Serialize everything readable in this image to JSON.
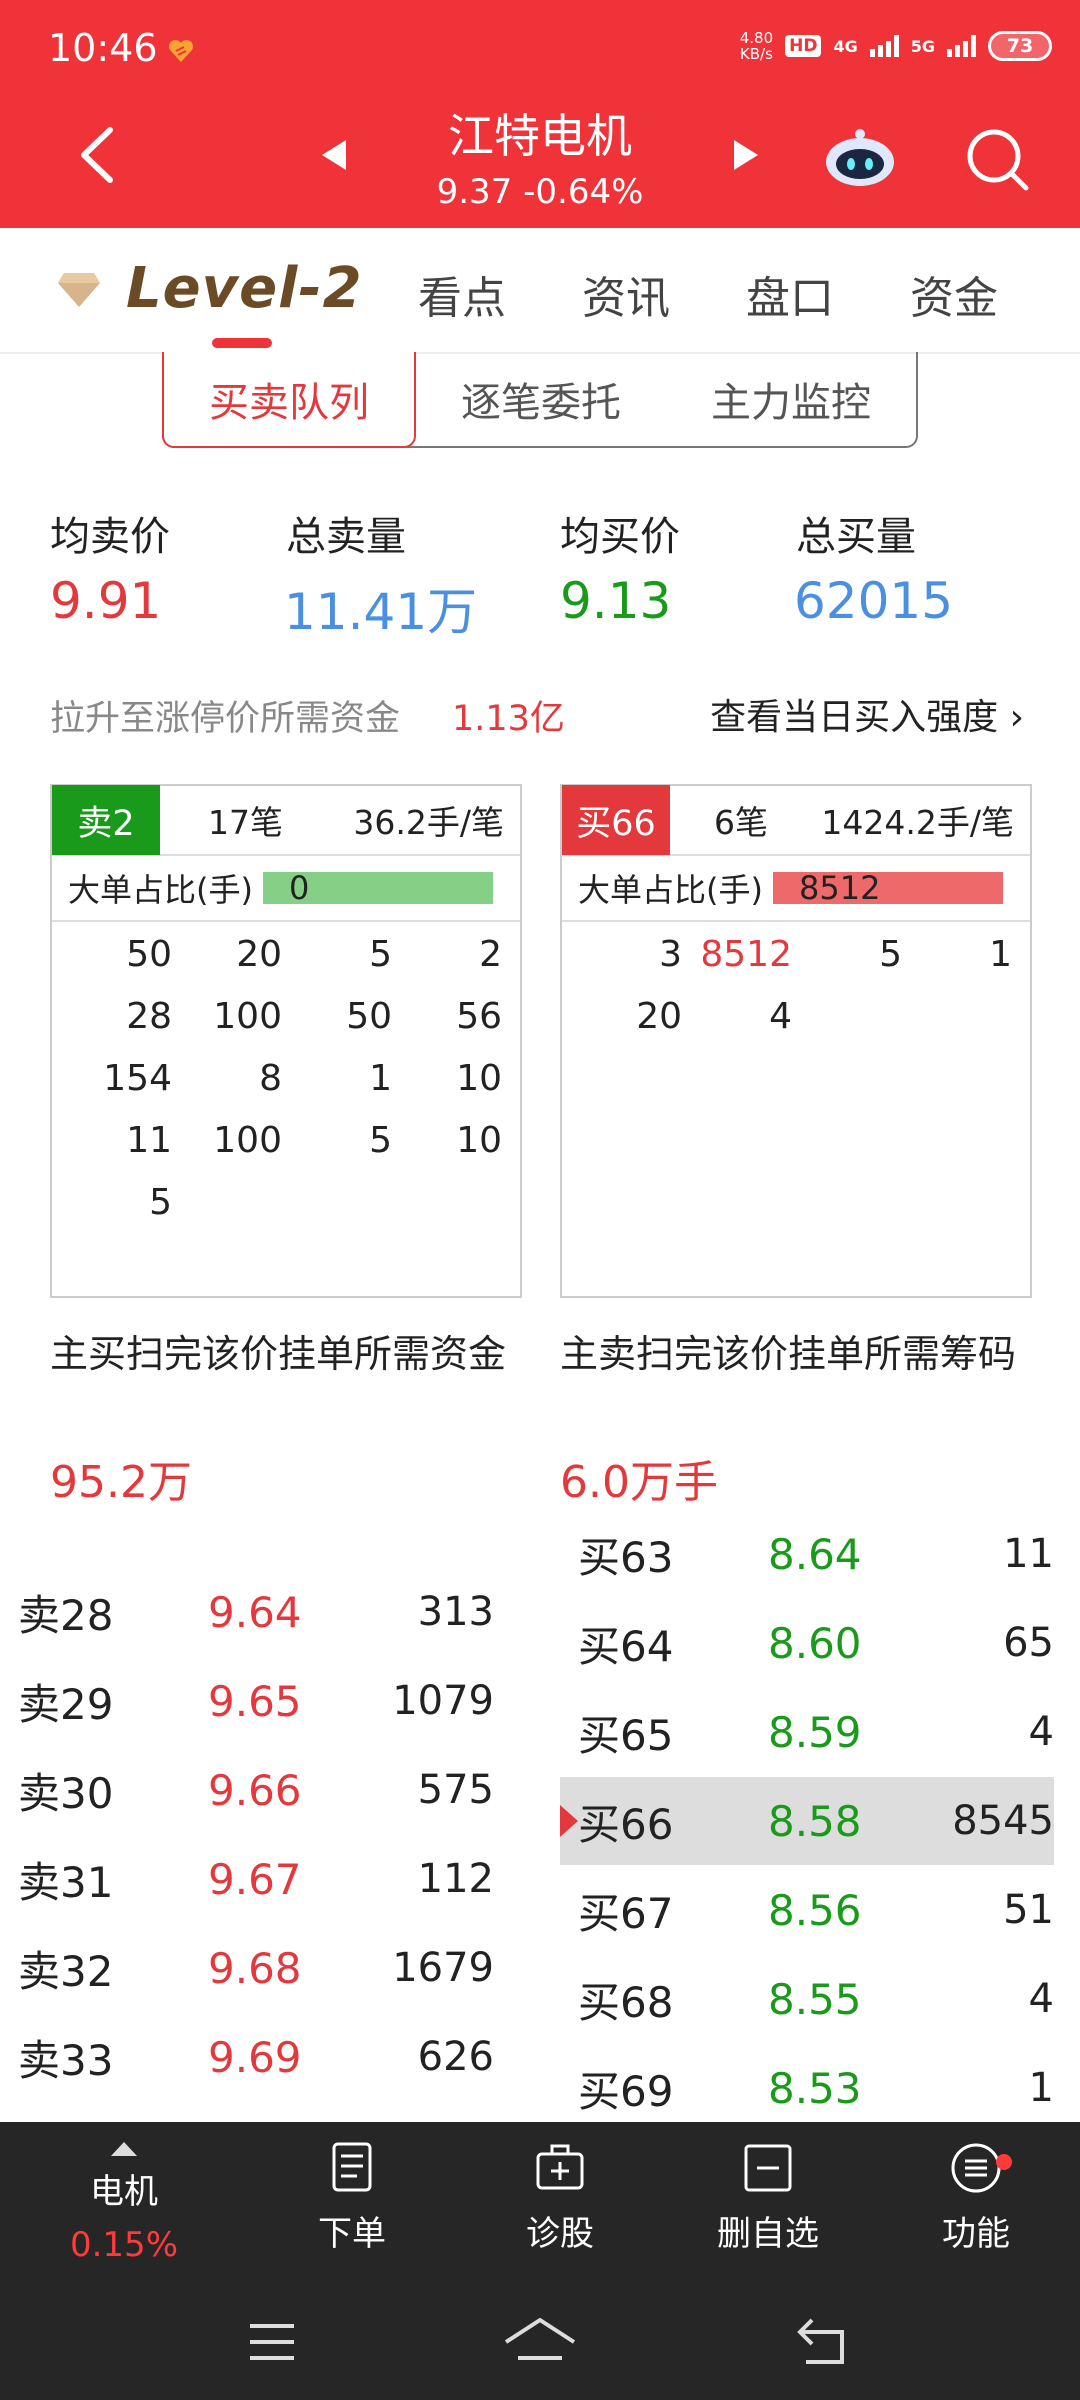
{
  "status": {
    "time": "10:46",
    "speed_top": "4.80",
    "speed_bottom": "KB/s",
    "hd": "HD",
    "net1": "4G",
    "net2": "5G",
    "battery": "73"
  },
  "header": {
    "stock_name": "江特电机",
    "quote": "9.37 -0.64%"
  },
  "tabs": {
    "level2": "Level-2",
    "items": [
      "看点",
      "资讯",
      "盘口",
      "资金"
    ]
  },
  "segmented": [
    "买卖队列",
    "逐笔委托",
    "主力监控"
  ],
  "stats": {
    "avg_sell_label": "均卖价",
    "avg_sell": "9.91",
    "total_sell_label": "总卖量",
    "total_sell": "11.41万",
    "avg_buy_label": "均买价",
    "avg_buy": "9.13",
    "total_buy_label": "总买量",
    "total_buy": "62015"
  },
  "raise": {
    "label": "拉升至涨停价所需资金",
    "value": "1.13亿",
    "link": "查看当日买入强度 ›"
  },
  "sell_queue": {
    "badge": "卖2",
    "count": "17笔",
    "avg": "36.2手/笔",
    "ratio_label": "大单占比(手)",
    "ratio_value": "0",
    "cells": [
      "50",
      "20",
      "5",
      "2",
      "28",
      "100",
      "50",
      "56",
      "154",
      "8",
      "1",
      "10",
      "11",
      "100",
      "5",
      "10",
      "5",
      "",
      "",
      ""
    ]
  },
  "buy_queue": {
    "badge": "买66",
    "count": "6笔",
    "avg": "1424.2手/笔",
    "ratio_label": "大单占比(手)",
    "ratio_value": "8512",
    "cells": [
      "3",
      "8512",
      "5",
      "1",
      "20",
      "4",
      "",
      ""
    ]
  },
  "sweep": {
    "buy_label": "主买扫完该价挂单所需资金",
    "buy_value": "95.2万",
    "sell_label": "主卖扫完该价挂单所需筹码",
    "sell_value": "6.0万手"
  },
  "sell_book": [
    {
      "name": "卖28",
      "price": "9.64",
      "vol": "313"
    },
    {
      "name": "卖29",
      "price": "9.65",
      "vol": "1079"
    },
    {
      "name": "卖30",
      "price": "9.66",
      "vol": "575"
    },
    {
      "name": "卖31",
      "price": "9.67",
      "vol": "112"
    },
    {
      "name": "卖32",
      "price": "9.68",
      "vol": "1679"
    },
    {
      "name": "卖33",
      "price": "9.69",
      "vol": "626"
    }
  ],
  "buy_book": [
    {
      "name": "买63",
      "price": "8.64",
      "vol": "11"
    },
    {
      "name": "买64",
      "price": "8.60",
      "vol": "65"
    },
    {
      "name": "买65",
      "price": "8.59",
      "vol": "4"
    },
    {
      "name": "买66",
      "price": "8.58",
      "vol": "8545"
    },
    {
      "name": "买67",
      "price": "8.56",
      "vol": "51"
    },
    {
      "name": "买68",
      "price": "8.55",
      "vol": "4"
    },
    {
      "name": "买69",
      "price": "8.53",
      "vol": "1"
    }
  ],
  "bottom": {
    "sector": "电机",
    "sector_pct": "0.15%",
    "order": "下单",
    "diagnose": "诊股",
    "remove_watch": "删自选",
    "functions": "功能"
  },
  "colors": {
    "header_red": "#f03239",
    "up_red": "#e4393c",
    "down_green": "#1a9a1a",
    "volume_blue": "#4a8fe0",
    "level2_brown": "#6b4a26"
  }
}
